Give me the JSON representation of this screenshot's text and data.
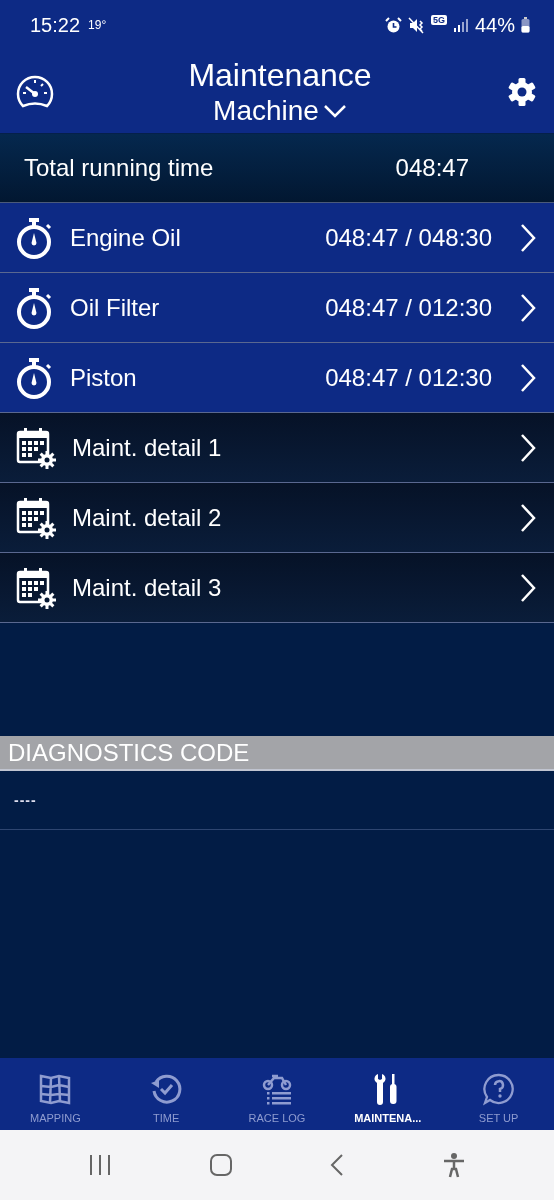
{
  "status_bar": {
    "time": "15:22",
    "temperature": "19°",
    "network": "5G",
    "battery": "44%"
  },
  "header": {
    "title": "Maintenance",
    "subtitle": "Machine"
  },
  "total": {
    "label": "Total running time",
    "value": "048:47"
  },
  "items": [
    {
      "kind": "timer",
      "label": "Engine Oil",
      "value": "048:47 / 048:30"
    },
    {
      "kind": "timer",
      "label": "Oil Filter",
      "value": "048:47 / 012:30"
    },
    {
      "kind": "timer",
      "label": "Piston",
      "value": "048:47 / 012:30"
    },
    {
      "kind": "schedule",
      "label": "Maint. detail 1"
    },
    {
      "kind": "schedule",
      "label": "Maint. detail 2"
    },
    {
      "kind": "schedule",
      "label": "Maint. detail 3"
    }
  ],
  "diagnostics": {
    "title": "DIAGNOSTICS CODE",
    "code": "----"
  },
  "tabs": [
    {
      "label": "MAPPING",
      "selected": false
    },
    {
      "label": "TIME",
      "selected": false
    },
    {
      "label": "RACE LOG",
      "selected": false
    },
    {
      "label": "MAINTENA...",
      "selected": true
    },
    {
      "label": "SET UP",
      "selected": false
    }
  ]
}
